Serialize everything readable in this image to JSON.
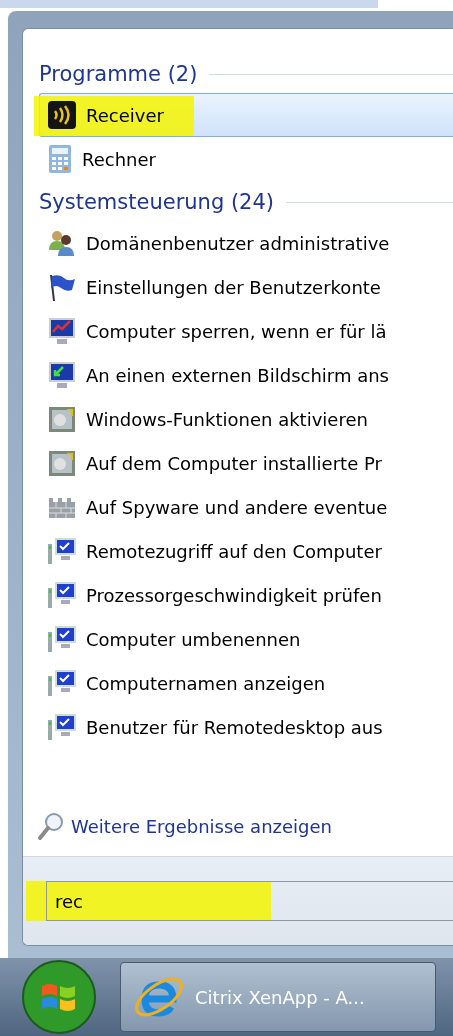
{
  "groups": [
    {
      "heading": "Programme (2)",
      "items": [
        {
          "label": "Receiver",
          "kind": "receiver",
          "selected": true,
          "marked": true
        },
        {
          "label": "Rechner",
          "kind": "calculator",
          "selected": false,
          "marked": false
        }
      ]
    },
    {
      "heading": "Systemsteuerung (24)",
      "items": [
        {
          "label": "Domänenbenutzer administrative",
          "kind": "users",
          "selected": false,
          "marked": false
        },
        {
          "label": "Einstellungen der Benutzerkonte",
          "kind": "flag",
          "selected": false,
          "marked": false
        },
        {
          "label": "Computer sperren, wenn er für lä",
          "kind": "monitor-pen",
          "selected": false,
          "marked": false
        },
        {
          "label": "An einen externen Bildschirm ans",
          "kind": "monitor-arrow",
          "selected": false,
          "marked": false
        },
        {
          "label": "Windows-Funktionen aktivieren",
          "kind": "programs",
          "selected": false,
          "marked": false
        },
        {
          "label": "Auf dem Computer installierte Pr",
          "kind": "programs",
          "selected": false,
          "marked": false
        },
        {
          "label": "Auf Spyware und andere eventue",
          "kind": "wall",
          "selected": false,
          "marked": false
        },
        {
          "label": "Remotezugriff auf den Computer",
          "kind": "system",
          "selected": false,
          "marked": false
        },
        {
          "label": "Prozessorgeschwindigkeit prüfen",
          "kind": "system",
          "selected": false,
          "marked": false
        },
        {
          "label": "Computer umbenennen",
          "kind": "system",
          "selected": false,
          "marked": false
        },
        {
          "label": "Computernamen anzeigen",
          "kind": "system",
          "selected": false,
          "marked": false
        },
        {
          "label": "Benutzer für Remotedesktop aus",
          "kind": "system",
          "selected": false,
          "marked": false
        }
      ]
    }
  ],
  "more_results": "Weitere Ergebnisse anzeigen",
  "search": {
    "value": "rec",
    "marked": true
  },
  "taskbar": {
    "buttons": [
      {
        "label": "Citrix XenApp - A..."
      }
    ]
  }
}
